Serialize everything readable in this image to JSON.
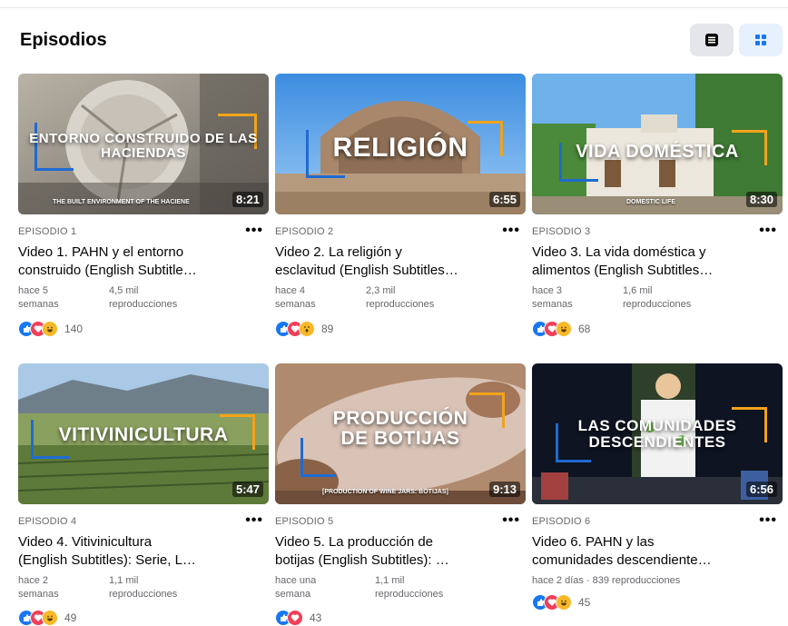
{
  "header": {
    "title": "Episodios"
  },
  "episodes": [
    {
      "thumb_title": "ENTORNO CONSTRUIDO DE LAS HACIENDAS",
      "thumb_subtitle": "THE BUILT ENVIRONMENT OF THE HACIENE",
      "duration": "8:21",
      "episode_label": "EPISODIO 1",
      "title": "Video 1. PAHN y el entorno construido (English Subtitle…",
      "title_line1": "Video 1. PAHN y el entorno",
      "title_line2": "construido (English Subtitle…",
      "ago": "hace 5 semanas",
      "views": "4,5 mil reproducciones",
      "reaction_count": "140",
      "reactions": [
        "like-icon",
        "love-icon",
        "haha-icon"
      ]
    },
    {
      "thumb_title": "RELIGIÓN",
      "thumb_subtitle": "",
      "duration": "6:55",
      "episode_label": "EPISODIO 2",
      "title_line1": "Video 2. La religión y",
      "title_line2": "esclavitud (English Subtitles…",
      "ago": "hace 4 semanas",
      "views": "2,3 mil reproducciones",
      "reaction_count": "89",
      "reactions": [
        "like-icon",
        "love-icon",
        "wow-icon"
      ]
    },
    {
      "thumb_title": "VIDA DOMÉSTICA",
      "thumb_subtitle": "DOMESTIC LIFE",
      "duration": "8:30",
      "episode_label": "EPISODIO 3",
      "title_line1": "Video 3. La vida doméstica y",
      "title_line2": "alimentos (English Subtitles…",
      "ago": "hace 3 semanas",
      "views": "1,6 mil reproducciones",
      "reaction_count": "68",
      "reactions": [
        "like-icon",
        "love-icon",
        "haha-icon"
      ]
    },
    {
      "thumb_title": "VITIVINICULTURA",
      "thumb_subtitle": "",
      "duration": "5:47",
      "episode_label": "EPISODIO 4",
      "title_line1": "Video 4. Vitivinicultura",
      "title_line2": "(English Subtitles): Serie, L…",
      "ago": "hace 2 semanas",
      "views": "1,1 mil reproducciones",
      "reaction_count": "49",
      "reactions": [
        "like-icon",
        "love-icon",
        "haha-icon"
      ]
    },
    {
      "thumb_title_line1": "PRODUCCIÓN",
      "thumb_title_line2": "DE BOTIJAS",
      "thumb_subtitle": "[PRODUCTION OF WINE JARS: BOTIJAS]",
      "duration": "9:13",
      "episode_label": "EPISODIO 5",
      "title_line1": "Video 5. La producción de",
      "title_line2": "botijas (English Subtitles): …",
      "ago": "hace una semana",
      "views": "1,1 mil reproducciones",
      "reaction_count": "43",
      "reactions": [
        "like-icon",
        "love-icon"
      ]
    },
    {
      "thumb_title_line1": "LAS COMUNIDADES",
      "thumb_title_line2": "DESCENDIENTES",
      "thumb_subtitle": "",
      "duration": "6:56",
      "episode_label": "EPISODIO 6",
      "title_line1": "Video 6. PAHN y las",
      "title_line2": "comunidades descendiente…",
      "meta_line": "hace 2 días · 839 reproducciones",
      "reaction_count": "45",
      "reactions": [
        "like-icon",
        "love-icon",
        "haha-icon"
      ]
    }
  ],
  "colors": {
    "frame_blue": "#1f6bd1",
    "frame_orange": "#f2a31b",
    "like": "#1877f2",
    "love": "#f33e58",
    "haha": "#f7b928",
    "meta_text": "#65676b"
  }
}
